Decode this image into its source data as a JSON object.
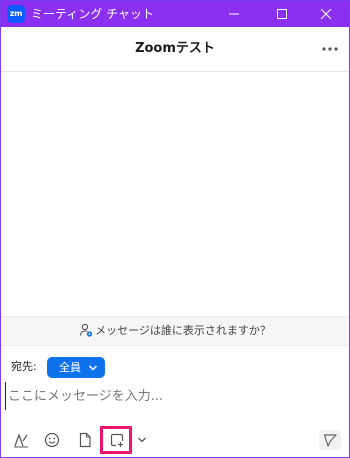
{
  "window": {
    "app_icon_text": "zm",
    "title": "ミーティング チャット",
    "controls": [
      "minimize",
      "maximize",
      "close"
    ]
  },
  "chat": {
    "title": "Zoomテスト"
  },
  "hint": {
    "text": "メッセージは誰に表示されますか？",
    "icon": "user-eye-icon"
  },
  "composer": {
    "to_label": "宛先:",
    "recipient": "全員",
    "placeholder": "ここにメッセージを入力..."
  },
  "toolbar": {
    "items": [
      "format-icon",
      "emoji-icon",
      "file-icon",
      "screenshot-icon",
      "chevron-down-icon",
      "send-icon"
    ],
    "highlighted": "screenshot-icon"
  },
  "colors": {
    "titlebar": "#8b2ff0",
    "accent": "#0e72ed",
    "highlight": "#e8156f"
  }
}
